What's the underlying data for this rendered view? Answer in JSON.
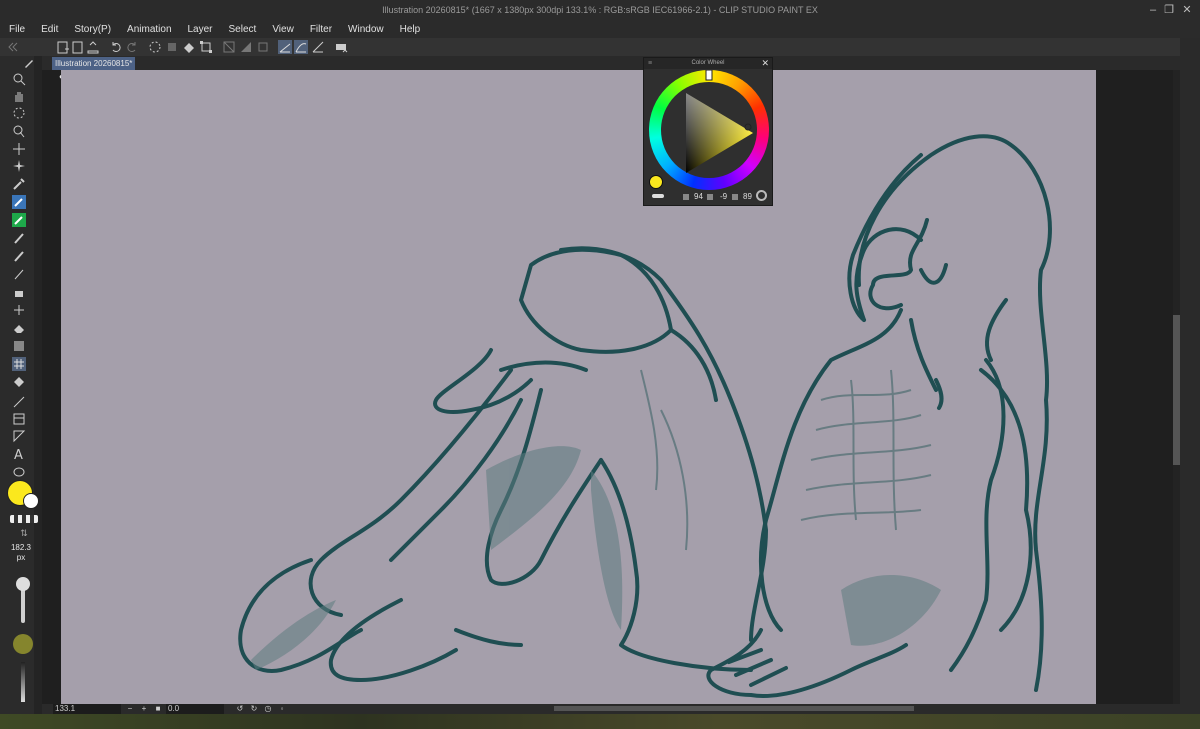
{
  "window": {
    "title": "Illustration 20260815* (1667 x 1380px 300dpi 133.1% : RGB:sRGB IEC61966-2.1)  - CLIP STUDIO PAINT EX"
  },
  "menu": [
    "File",
    "Edit",
    "Story(P)",
    "Animation",
    "Layer",
    "Select",
    "View",
    "Filter",
    "Window",
    "Help"
  ],
  "document_tab": {
    "label": "Illustration 20260815*"
  },
  "color_wheel": {
    "title": "Color Wheel",
    "value_a": "94",
    "value_b": "-9",
    "value_c": "89"
  },
  "tool_palette": {
    "brush_size": "182.3",
    "brush_unit": "px",
    "main_color": "#fbe81e",
    "sub_color": "#ffffff",
    "opacity_color": "#85852d"
  },
  "status": {
    "zoom": "133.1",
    "rotation": "0.0"
  },
  "colors": {
    "canvas_bg": "#a59fab",
    "line_color": "#1f4e52",
    "accent": "#3a75b8"
  }
}
